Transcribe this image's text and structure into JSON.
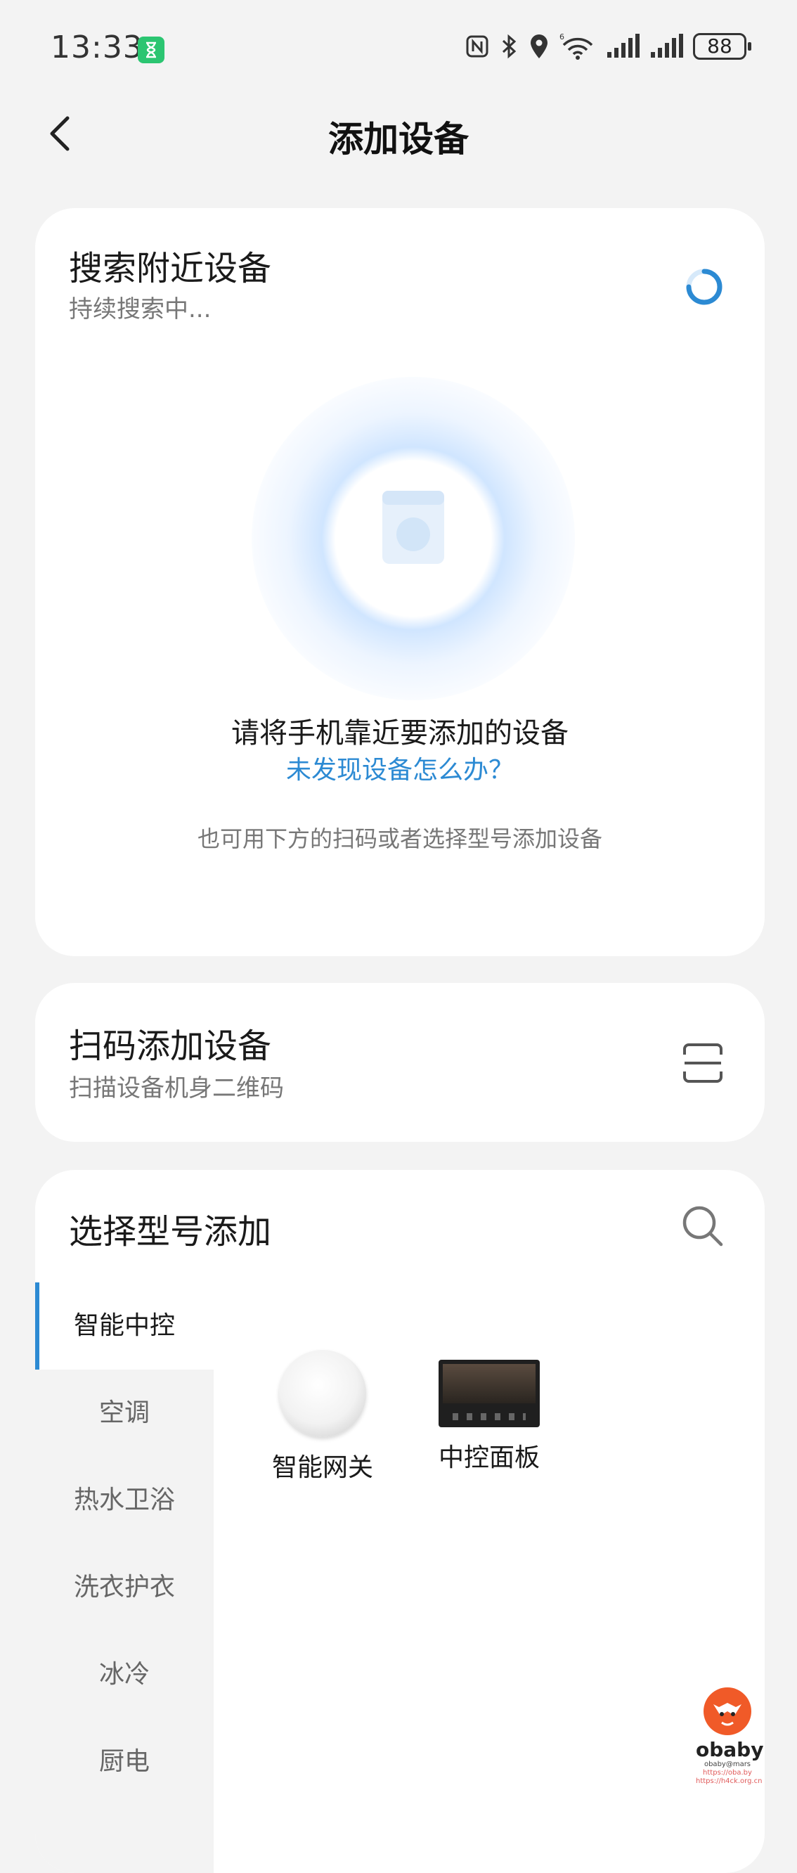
{
  "status_bar": {
    "time": "13:33",
    "battery": "88",
    "icons": [
      "hourglass-icon",
      "nfc-icon",
      "bluetooth-icon",
      "location-icon",
      "wifi-icon",
      "signal-icon",
      "signal-icon",
      "battery-icon"
    ]
  },
  "header": {
    "title": "添加设备",
    "back_icon": "chevron-left-icon"
  },
  "search_card": {
    "title": "搜索附近设备",
    "subtitle": "持续搜索中...",
    "prompt": "请将手机靠近要添加的设备",
    "help_link": "未发现设备怎么办？",
    "hint": "也可用下方的扫码或者选择型号添加设备",
    "accent": "#2c8ad3"
  },
  "scan_card": {
    "title": "扫码添加设备",
    "subtitle": "扫描设备机身二维码",
    "icon": "scan-icon"
  },
  "model_card": {
    "title": "选择型号添加",
    "search_icon": "search-icon",
    "categories": [
      {
        "label": "智能中控",
        "active": true
      },
      {
        "label": "空调",
        "active": false
      },
      {
        "label": "热水卫浴",
        "active": false
      },
      {
        "label": "洗衣护衣",
        "active": false
      },
      {
        "label": "冰冷",
        "active": false
      },
      {
        "label": "厨电",
        "active": false
      }
    ],
    "products": [
      {
        "label": "智能网关",
        "image": "gateway-image"
      },
      {
        "label": "中控面板",
        "image": "control-panel-image"
      }
    ]
  },
  "watermark": {
    "brand": "obaby",
    "sub1": "obaby@mars",
    "sub2": "https://oba.by",
    "sub3": "https://h4ck.org.cn"
  }
}
